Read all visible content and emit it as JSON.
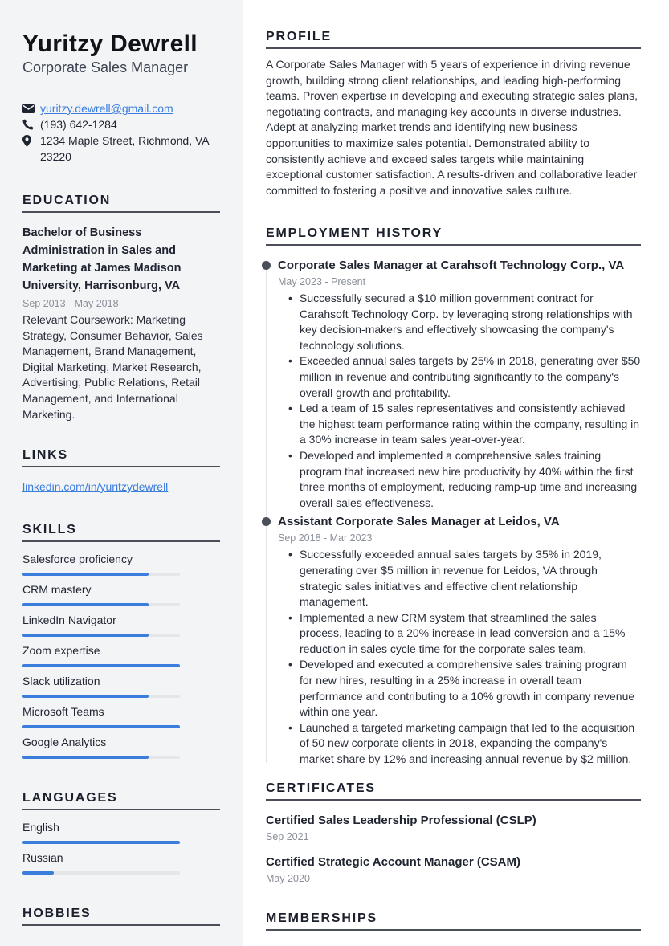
{
  "header": {
    "name": "Yuritzy Dewrell",
    "title": "Corporate Sales Manager"
  },
  "contact": {
    "email": "yuritzy.dewrell@gmail.com",
    "phone": "(193) 642-1284",
    "address": "1234 Maple Street, Richmond, VA 23220",
    "icons": [
      "envelope-icon",
      "phone-icon",
      "map-pin-icon"
    ]
  },
  "education": {
    "heading": "EDUCATION",
    "degree": "Bachelor of Business Administration in Sales and Marketing at James Madison University, Harrisonburg, VA",
    "dates": "Sep 2013 - May 2018",
    "description": "Relevant Coursework: Marketing Strategy, Consumer Behavior, Sales Management, Brand Management, Digital Marketing, Market Research, Advertising, Public Relations, Retail Management, and International Marketing."
  },
  "links": {
    "heading": "LINKS",
    "items": [
      {
        "label": "linkedin.com/in/yuritzydewrell"
      }
    ]
  },
  "skills": {
    "heading": "SKILLS",
    "accent_color": "#3b7ddd",
    "items": [
      {
        "label": "Salesforce proficiency",
        "level": 0.8
      },
      {
        "label": "CRM mastery",
        "level": 0.8
      },
      {
        "label": "LinkedIn Navigator",
        "level": 0.8
      },
      {
        "label": "Zoom expertise",
        "level": 1.0
      },
      {
        "label": "Slack utilization",
        "level": 0.8
      },
      {
        "label": "Microsoft Teams",
        "level": 1.0
      },
      {
        "label": "Google Analytics",
        "level": 0.8
      }
    ]
  },
  "languages": {
    "heading": "LANGUAGES",
    "items": [
      {
        "label": "English",
        "level": 1.0
      },
      {
        "label": "Russian",
        "level": 0.2
      }
    ]
  },
  "hobbies": {
    "heading": "HOBBIES"
  },
  "profile": {
    "heading": "PROFILE",
    "text": "A Corporate Sales Manager with 5 years of experience in driving revenue growth, building strong client relationships, and leading high-performing teams. Proven expertise in developing and executing strategic sales plans, negotiating contracts, and managing key accounts in diverse industries. Adept at analyzing market trends and identifying new business opportunities to maximize sales potential. Demonstrated ability to consistently achieve and exceed sales targets while maintaining exceptional customer satisfaction. A results-driven and collaborative leader committed to fostering a positive and innovative sales culture."
  },
  "employment": {
    "heading": "EMPLOYMENT HISTORY",
    "jobs": [
      {
        "title": "Corporate Sales Manager at Carahsoft Technology Corp., VA",
        "dates": "May 2023 - Present",
        "bullets": [
          "Successfully secured a $10 million government contract for Carahsoft Technology Corp. by leveraging strong relationships with key decision-makers and effectively showcasing the company's technology solutions.",
          "Exceeded annual sales targets by 25% in 2018, generating over $50 million in revenue and contributing significantly to the company's overall growth and profitability.",
          "Led a team of 15 sales representatives and consistently achieved the highest team performance rating within the company, resulting in a 30% increase in team sales year-over-year.",
          "Developed and implemented a comprehensive sales training program that increased new hire productivity by 40% within the first three months of employment, reducing ramp-up time and increasing overall sales effectiveness."
        ]
      },
      {
        "title": "Assistant Corporate Sales Manager at Leidos, VA",
        "dates": "Sep 2018 - Mar 2023",
        "bullets": [
          "Successfully exceeded annual sales targets by 35% in 2019, generating over $5 million in revenue for Leidos, VA through strategic sales initiatives and effective client relationship management.",
          "Implemented a new CRM system that streamlined the sales process, leading to a 20% increase in lead conversion and a 15% reduction in sales cycle time for the corporate sales team.",
          "Developed and executed a comprehensive sales training program for new hires, resulting in a 25% increase in overall team performance and contributing to a 10% growth in company revenue within one year.",
          "Launched a targeted marketing campaign that led to the acquisition of 50 new corporate clients in 2018, expanding the company's market share by 12% and increasing annual revenue by $2 million."
        ]
      }
    ]
  },
  "certificates": {
    "heading": "CERTIFICATES",
    "items": [
      {
        "name": "Certified Sales Leadership Professional (CSLP)",
        "date": "Sep 2021"
      },
      {
        "name": "Certified Strategic Account Manager (CSAM)",
        "date": "May 2020"
      }
    ]
  },
  "memberships": {
    "heading": "MEMBERSHIPS"
  }
}
